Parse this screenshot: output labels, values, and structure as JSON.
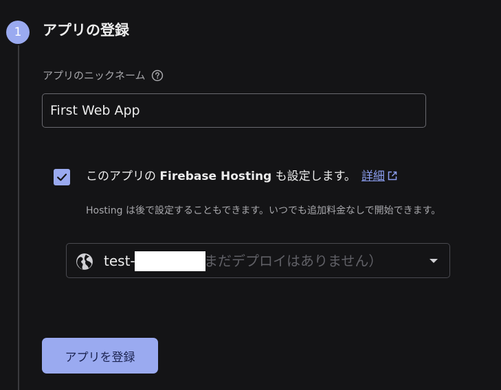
{
  "step": {
    "number": "1",
    "title": "アプリの登録"
  },
  "nickname": {
    "label": "アプリのニックネーム",
    "value": "First Web App",
    "help_icon": "help-circle-icon"
  },
  "hosting": {
    "checked": true,
    "label_prefix": "このアプリの",
    "label_brand": "Firebase Hosting",
    "label_suffix": "も設定します。",
    "details_link": "詳細",
    "link_icon": "open-in-new-icon",
    "hint": "Hosting は後で設定することもできます。いつでも追加料金なしで開始できます。"
  },
  "site_select": {
    "icon": "globe-icon",
    "prefix": "test-",
    "status": "まだデプロイはありません）"
  },
  "register_button": {
    "label": "アプリを登録"
  },
  "colors": {
    "background": "#141416",
    "accent": "#9aaaf0",
    "link": "#8c9ef0",
    "text": "#ececec",
    "muted": "#a8a8ac"
  }
}
